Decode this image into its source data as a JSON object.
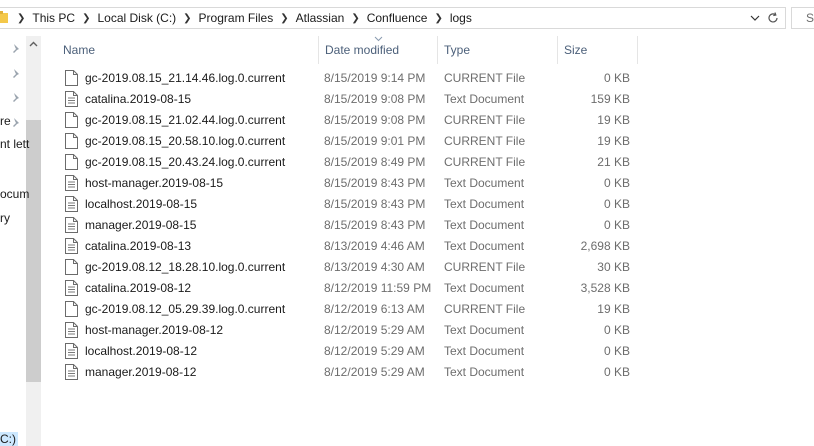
{
  "address_bar": {
    "breadcrumbs": [
      "This PC",
      "Local Disk (C:)",
      "Program Files",
      "Atlassian",
      "Confluence",
      "logs"
    ],
    "search_placeholder": "Se"
  },
  "nav_pane": {
    "fragments": [
      "re",
      "nt lett",
      "ocum",
      "ry"
    ],
    "bottom_item": "C:)"
  },
  "columns": {
    "name": "Name",
    "date_modified": "Date modified",
    "type": "Type",
    "size": "Size"
  },
  "files": [
    {
      "name": "gc-2019.08.15_21.14.46.log.0.current",
      "date": "8/15/2019 9:14 PM",
      "type": "CURRENT File",
      "size": "0 KB"
    },
    {
      "name": "catalina.2019-08-15",
      "date": "8/15/2019 9:08 PM",
      "type": "Text Document",
      "size": "159 KB"
    },
    {
      "name": "gc-2019.08.15_21.02.44.log.0.current",
      "date": "8/15/2019 9:08 PM",
      "type": "CURRENT File",
      "size": "19 KB"
    },
    {
      "name": "gc-2019.08.15_20.58.10.log.0.current",
      "date": "8/15/2019 9:01 PM",
      "type": "CURRENT File",
      "size": "19 KB"
    },
    {
      "name": "gc-2019.08.15_20.43.24.log.0.current",
      "date": "8/15/2019 8:49 PM",
      "type": "CURRENT File",
      "size": "21 KB"
    },
    {
      "name": "host-manager.2019-08-15",
      "date": "8/15/2019 8:43 PM",
      "type": "Text Document",
      "size": "0 KB"
    },
    {
      "name": "localhost.2019-08-15",
      "date": "8/15/2019 8:43 PM",
      "type": "Text Document",
      "size": "0 KB"
    },
    {
      "name": "manager.2019-08-15",
      "date": "8/15/2019 8:43 PM",
      "type": "Text Document",
      "size": "0 KB"
    },
    {
      "name": "catalina.2019-08-13",
      "date": "8/13/2019 4:46 AM",
      "type": "Text Document",
      "size": "2,698 KB"
    },
    {
      "name": "gc-2019.08.12_18.28.10.log.0.current",
      "date": "8/13/2019 4:30 AM",
      "type": "CURRENT File",
      "size": "30 KB"
    },
    {
      "name": "catalina.2019-08-12",
      "date": "8/12/2019 11:59 PM",
      "type": "Text Document",
      "size": "3,528 KB"
    },
    {
      "name": "gc-2019.08.12_05.29.39.log.0.current",
      "date": "8/12/2019 6:13 AM",
      "type": "CURRENT File",
      "size": "19 KB"
    },
    {
      "name": "host-manager.2019-08-12",
      "date": "8/12/2019 5:29 AM",
      "type": "Text Document",
      "size": "0 KB"
    },
    {
      "name": "localhost.2019-08-12",
      "date": "8/12/2019 5:29 AM",
      "type": "Text Document",
      "size": "0 KB"
    },
    {
      "name": "manager.2019-08-12",
      "date": "8/12/2019 5:29 AM",
      "type": "Text Document",
      "size": "0 KB"
    }
  ]
}
